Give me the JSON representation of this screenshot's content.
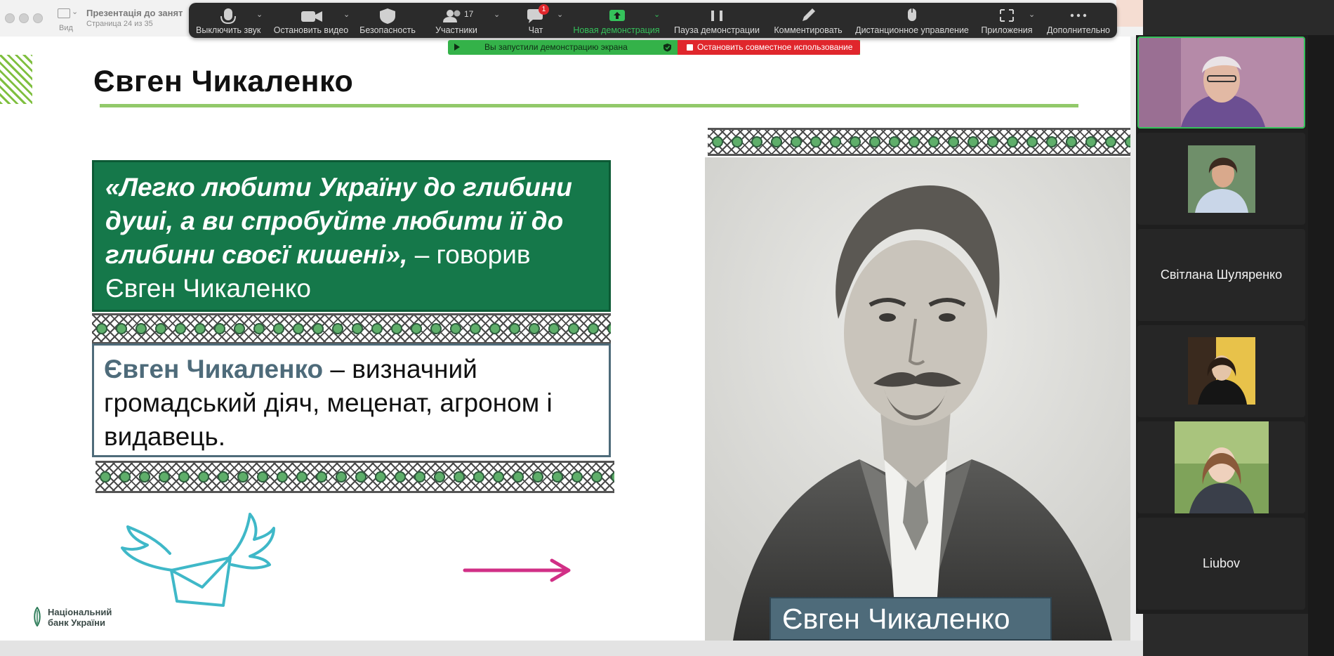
{
  "keynote": {
    "view_label": "Вид",
    "doc_title": "Презентація до занят",
    "doc_subtitle": "Страница 24 из 35"
  },
  "zoom_toolbar": {
    "mute": "Выключить звук",
    "stop_video": "Остановить видео",
    "security": "Безопасность",
    "participants": "Участники",
    "participants_count": "17",
    "chat": "Чат",
    "chat_badge": "1",
    "new_share": "Новая демонстрация",
    "pause_share": "Пауза демонстрации",
    "annotate": "Комментировать",
    "remote_control": "Дистанционное управление",
    "apps": "Приложения",
    "more": "Дополнительно"
  },
  "share_banner": {
    "status": "Вы запустили демонстрацию экрана",
    "stop": "Остановить совместное использование"
  },
  "slide": {
    "title": "Євген Чикаленко",
    "quote_italic": "«Легко любити Україну до глибини душі, а ви спробуйте любити її до глибини своєї кишені»,",
    "quote_rest": " – говорив Євген Чикаленко",
    "desc_name": "Євген Чикаленко",
    "desc_rest": " – визначний громадський діяч, меценат, агроном і видавець.",
    "caption": "Євген Чикаленко",
    "logo_line1": "Національний",
    "logo_line2": "банк України"
  },
  "gallery": {
    "participants": [
      {
        "name": ""
      },
      {
        "name": ""
      },
      {
        "name": "Світлана Шуляренко"
      },
      {
        "name": ""
      },
      {
        "name": ""
      },
      {
        "name": "Liubov"
      }
    ]
  },
  "colors": {
    "slide_green": "#15784a",
    "slide_slate": "#4e6b7a",
    "accent_rule": "#92c96a",
    "zoom_green": "#35c25b",
    "zoom_red": "#e0262c"
  }
}
